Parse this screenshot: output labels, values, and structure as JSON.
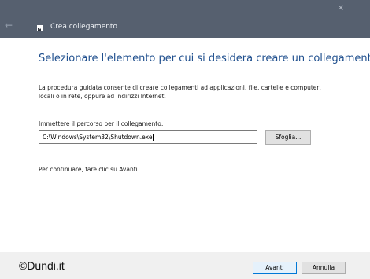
{
  "window": {
    "title": "Crea collegamento",
    "back_icon": "back-arrow-icon",
    "close_icon": "close-icon"
  },
  "main": {
    "heading": "Selezionare l'elemento per cui si desidera creare un collegamento.",
    "description": "La procedura guidata consente di creare collegamenti ad applicazioni, file, cartelle e computer, locali o in rete, oppure ad indirizzi Internet.",
    "path_label": "Immettere il percorso per il collegamento:",
    "path_value": "C:\\Windows\\System32\\Shutdown.exe",
    "browse_label": "Sfoglia...",
    "continue_note": "Per continuare, fare clic su Avanti."
  },
  "footer": {
    "watermark": "©Dundi.it",
    "next_label": "Avanti",
    "cancel_label": "Annulla"
  },
  "colors": {
    "titlebar": "#56606f",
    "heading": "#1f4f8e",
    "default_button_border": "#0078d7"
  }
}
